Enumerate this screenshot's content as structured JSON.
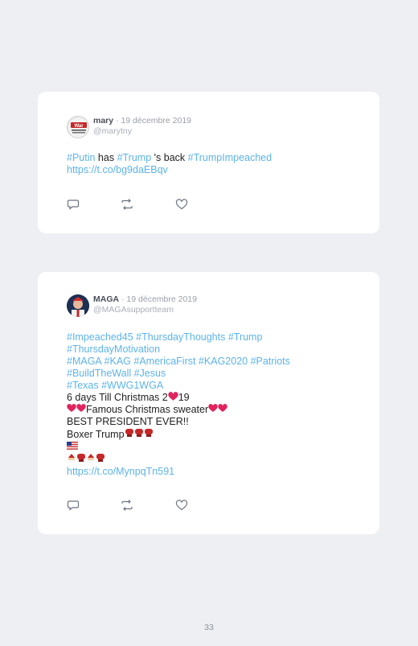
{
  "tweets": [
    {
      "name": "mary",
      "date": " · 19 décembre 2019",
      "handle": "@marytny",
      "avatar_text": "War",
      "text_parts": [
        {
          "t": "#Putin",
          "c": "tag"
        },
        {
          "t": " has ",
          "c": ""
        },
        {
          "t": "#Trump",
          "c": "tag"
        },
        {
          "t": " 's back ",
          "c": ""
        },
        {
          "t": "#TrumpImpeached",
          "c": "tag"
        }
      ],
      "link": "https://t.co/bg9daEBqv"
    },
    {
      "name": "MAGA",
      "date": " · 19 décembre 2019",
      "handle": "@MAGAsupportteam",
      "hashtags_line1": "#Impeached45 #ThursdayThoughts #Trump",
      "hashtags_line2": "#ThursdayMotivation",
      "hashtags_line3": "#MAGA #KAG #AmericaFirst #KAG2020 #Patriots",
      "hashtags_line4": "#BuildTheWall #Jesus",
      "hashtags_line5": "#Texas #WWG1WGA",
      "line6": "6 days Till Christmas 2",
      "line6_end": "19",
      "line7": "Famous Christmas sweater",
      "line8": "BEST PRESIDENT EVER!!",
      "line9": "Boxer Trump",
      "link": "https://t.co/MynpqTn591"
    }
  ],
  "page_number": "33",
  "icons": [
    "reply-icon",
    "retweet-icon",
    "like-icon",
    "heart-emoji",
    "boxing-glove-emoji",
    "us-flag-emoji",
    "santa-emoji"
  ]
}
